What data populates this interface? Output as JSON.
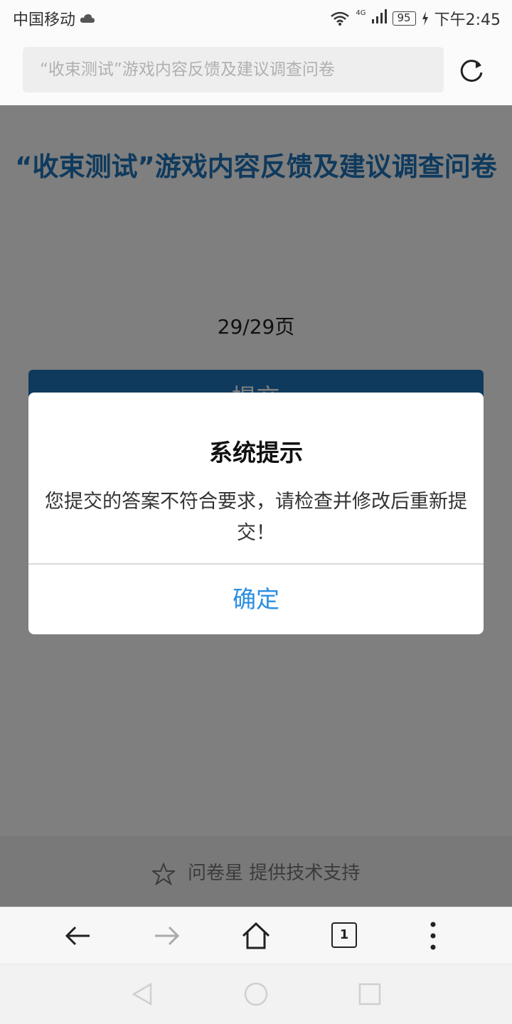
{
  "status_bar": {
    "carrier": "中国移动",
    "network": "4G",
    "battery": "95",
    "time": "下午2:45"
  },
  "url_bar": {
    "text": "“收束测试”游戏内容反馈及建议调查问卷"
  },
  "page": {
    "title": "“收束测试”游戏内容反馈及建议调查问卷",
    "page_indicator": "29/29页",
    "submit_label": "提交",
    "support_text": "问卷星 提供技术支持"
  },
  "dialog": {
    "title": "系统提示",
    "message": "您提交的答案不符合要求，请检查并修改后重新提交！",
    "confirm_label": "确定"
  },
  "toolbar": {
    "tab_count": "1"
  },
  "colors": {
    "accent": "#1f74ba",
    "dialog_button": "#2a8ee0"
  }
}
